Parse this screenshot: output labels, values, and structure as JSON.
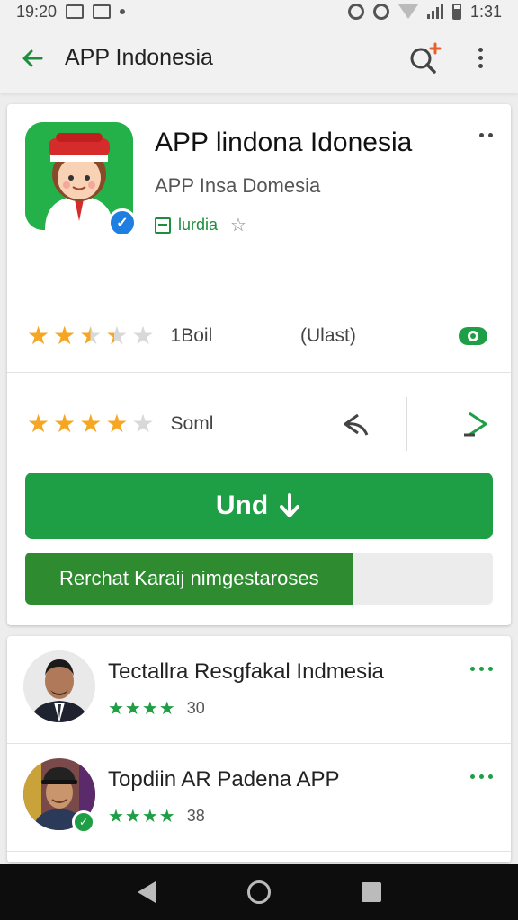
{
  "statusbar": {
    "time_left": "19:20",
    "time_right": "1:31"
  },
  "appbar": {
    "title": "APP Indonesia"
  },
  "app": {
    "title": "APP lindona Idonesia",
    "developer": "APP Insa Domesia",
    "tag": "lurdia",
    "rating1": {
      "stars": 3.5,
      "count": "1Boil",
      "meta": "(Ulast)"
    },
    "rating2": {
      "stars": 4,
      "count": "Soml"
    },
    "install_label": "Und",
    "progress": {
      "label": "Rerchat Karaij nimgestaroses",
      "fraction": 0.7
    }
  },
  "list": [
    {
      "title": "Tectallra Resgfakal Indmesia",
      "stars": "★★★★",
      "count": "30"
    },
    {
      "title": "Topdiin AR Padena APP",
      "stars": "★★★★",
      "count": "38"
    }
  ],
  "colors": {
    "accent": "#1e9e45",
    "star": "#f5a623",
    "progress": "#2e8b30"
  }
}
